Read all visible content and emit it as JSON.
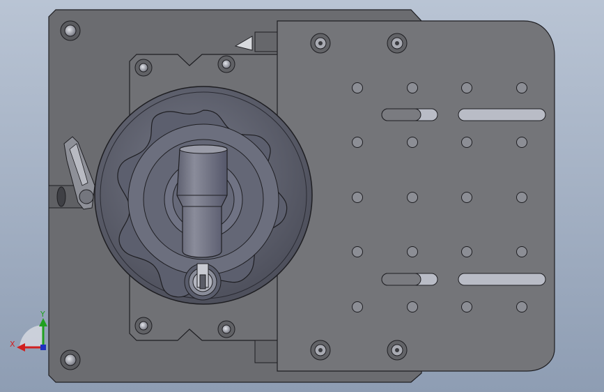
{
  "viewport": {
    "background_top": "#b9c4d4",
    "background_bottom": "#8e9db3"
  },
  "model": {
    "base_plate_color": "#6b6c70",
    "edge_color": "#1e1e22",
    "right_plate_color": "#747579",
    "handwheel_color": "#5a5c6a",
    "handwheel_inner_color": "#6e7080",
    "knob_color": "#7a7c8a",
    "slot_color": "#b9bcc6"
  },
  "triad": {
    "x_label": "X",
    "y_label": "Y",
    "x_color": "#d02020",
    "y_color": "#20a020"
  }
}
